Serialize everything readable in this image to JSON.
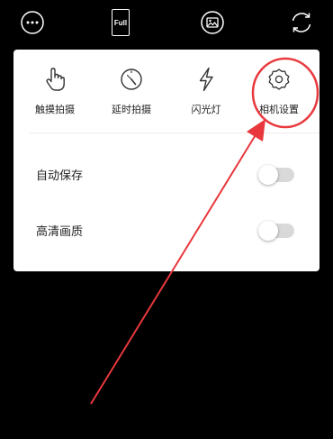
{
  "toolbar": {
    "more_icon": "more-dots-icon",
    "full_label": "Full",
    "gallery_icon": "gallery-icon",
    "switch_camera_icon": "switch-camera-icon"
  },
  "modes": [
    {
      "label": "触摸拍摄",
      "icon": "touch-icon"
    },
    {
      "label": "延时拍摄",
      "icon": "timer-icon"
    },
    {
      "label": "闪光灯",
      "icon": "flash-icon"
    },
    {
      "label": "相机设置",
      "icon": "settings-gear-icon"
    }
  ],
  "settings": [
    {
      "label": "自动保存",
      "enabled": false
    },
    {
      "label": "高清画质",
      "enabled": false
    }
  ],
  "colors": {
    "background": "#000000",
    "panel": "#ffffff",
    "annotation": "#e8383d",
    "toggle_track": "#d9d9d9"
  }
}
